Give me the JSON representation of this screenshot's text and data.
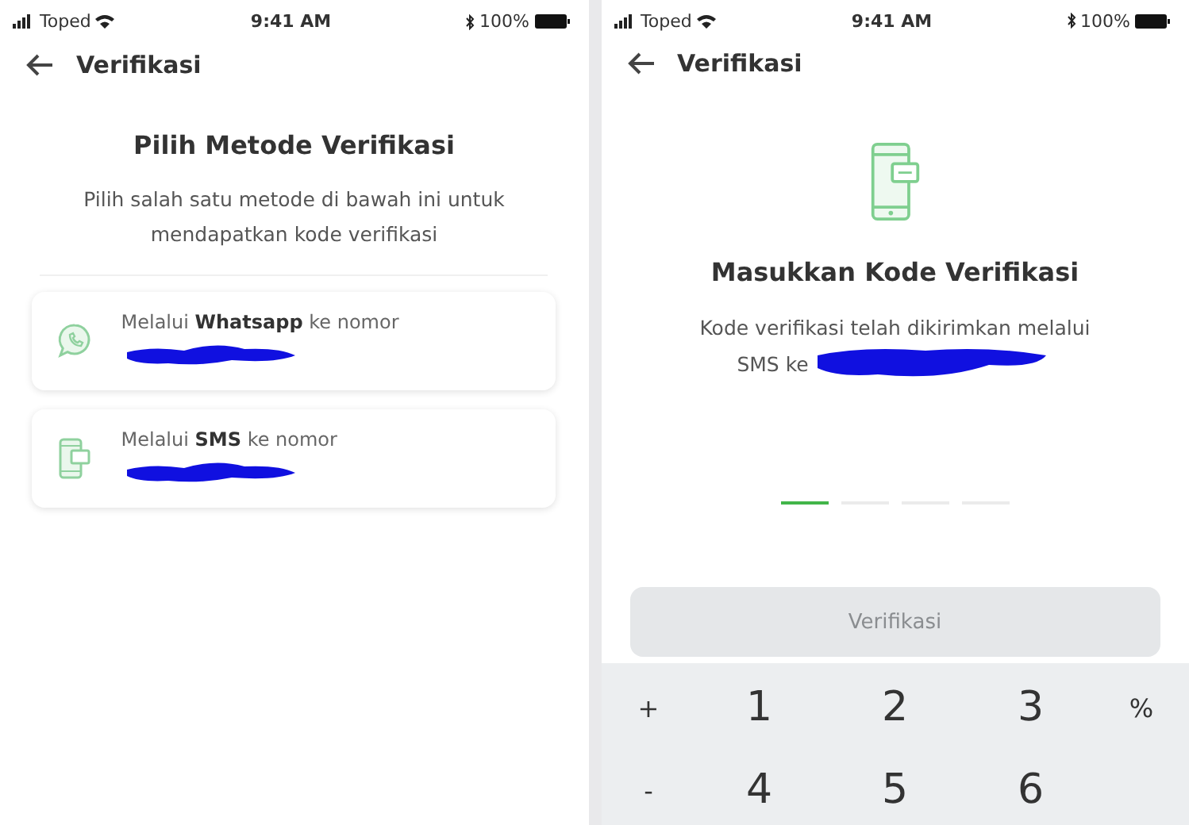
{
  "screens": [
    {
      "kind": "methods",
      "status_bar": {
        "carrier": "Toped",
        "time": "9:41 AM",
        "battery": "100%"
      },
      "header": {
        "title": "Verifikasi"
      },
      "heading": "Pilih Metode Verifikasi",
      "description": "Pilih salah satu metode di bawah ini untuk mendapatkan kode verifikasi",
      "methods": [
        {
          "kind": "whatsapp",
          "label": "Melalui **Whatsapp** ke nomor"
        },
        {
          "kind": "sms",
          "label": "Melalui **SMS** ke nomor"
        }
      ]
    },
    {
      "kind": "code",
      "status_bar": {
        "carrier": "Toped",
        "time": "9:41 AM",
        "battery": "100%"
      },
      "header": {
        "title": "Verifikasi"
      },
      "heading": "Masukkan Kode Verifikasi",
      "description": "Kode verifikasi telah dikirimkan melalui",
      "description_2": "SMS ke",
      "code_slots": [
        {
          "selected": true
        },
        {
          "selected": false
        },
        {
          "selected": false
        },
        {
          "selected": false
        }
      ],
      "button": {
        "label": "Verifikasi",
        "disabled": true
      },
      "keypad": [
        [
          "+",
          "1",
          "2",
          "3",
          "%"
        ],
        [
          "-",
          "4",
          "5",
          "6"
        ]
      ]
    }
  ]
}
